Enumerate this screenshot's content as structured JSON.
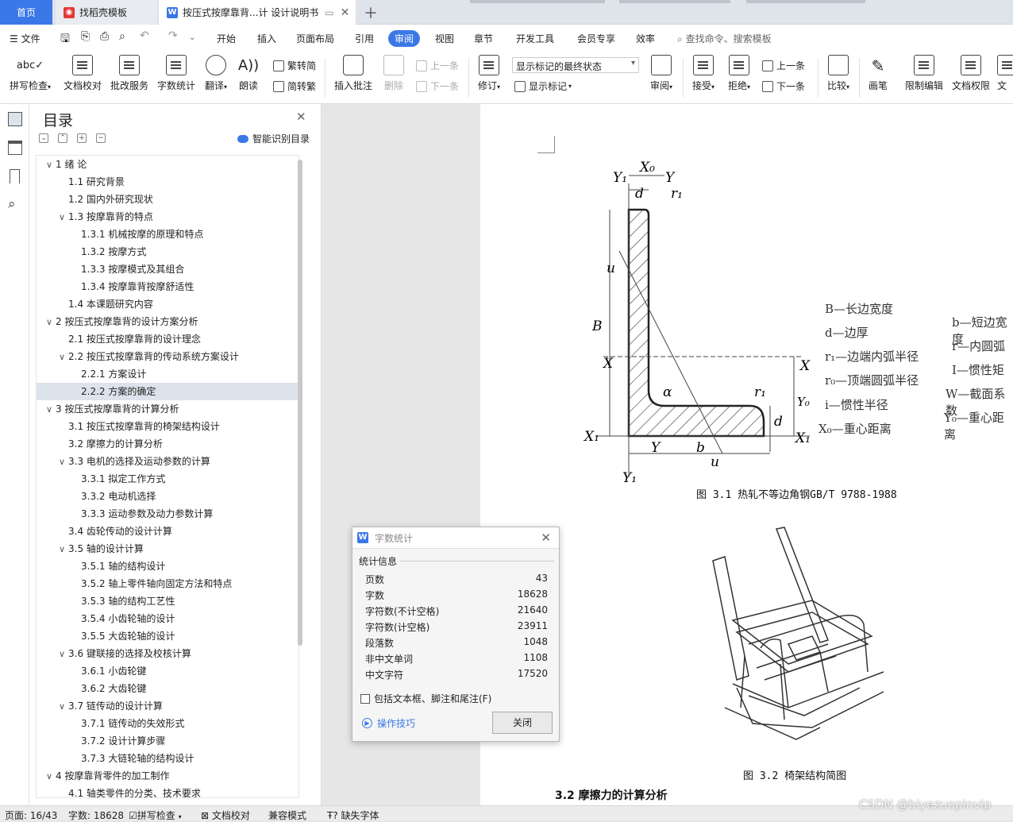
{
  "tabs": {
    "home": "首页",
    "find_template": "找稻壳模板",
    "doc_title": "按压式按摩靠背...计 设计说明书"
  },
  "menu": {
    "file": "文件",
    "items": [
      "开始",
      "插入",
      "页面布局",
      "引用",
      "审阅",
      "视图",
      "章节",
      "开发工具",
      "会员专享",
      "效率"
    ],
    "search": "查找命令、搜索模板"
  },
  "ribbon": {
    "spell": "拼写检查",
    "proof": "文档校对",
    "annot_service": "批改服务",
    "wordcount": "字数统计",
    "translate": "翻译",
    "read": "朗读",
    "trad": "繁转简",
    "simp": "简转繁",
    "insert_comment": "插入批注",
    "delete": "删除",
    "prev": "上一条",
    "next": "下一条",
    "track": "修订",
    "markup_state": "显示标记的最终状态",
    "show_markup": "显示标记",
    "review": "审阅",
    "accept": "接受",
    "reject": "拒绝",
    "prev2": "上一条",
    "next2": "下一条",
    "compare": "比较",
    "pen": "画笔",
    "restrict": "限制编辑",
    "doc_perm": "文档权限",
    "more": "文"
  },
  "toc": {
    "title": "目录",
    "smart": "智能识别目录",
    "items": [
      {
        "label": "1   绪   论",
        "level": 1,
        "arrow": "∨"
      },
      {
        "label": "1.1  研究背景",
        "level": 2,
        "arrow": ""
      },
      {
        "label": "1.2  国内外研究现状",
        "level": 2,
        "arrow": ""
      },
      {
        "label": "1.3  按摩靠背的特点",
        "level": 2,
        "arrow": "∨"
      },
      {
        "label": "1.3.1 机械按摩的原理和特点",
        "level": 3,
        "arrow": ""
      },
      {
        "label": "1.3.2 按摩方式",
        "level": 3,
        "arrow": ""
      },
      {
        "label": "1.3.3 按摩模式及其组合",
        "level": 3,
        "arrow": ""
      },
      {
        "label": "1.3.4 按摩靠背按摩舒适性",
        "level": 3,
        "arrow": ""
      },
      {
        "label": "1.4  本课题研究内容",
        "level": 2,
        "arrow": ""
      },
      {
        "label": "2   按压式按摩靠背的设计方案分析",
        "level": 1,
        "arrow": "∨"
      },
      {
        "label": "2.1  按压式按摩靠背的设计理念",
        "level": 2,
        "arrow": ""
      },
      {
        "label": "2.2  按压式按摩靠背的传动系统方案设计",
        "level": 2,
        "arrow": "∨"
      },
      {
        "label": "2.2.1 方案设计",
        "level": 3,
        "arrow": ""
      },
      {
        "label": "2.2.2 方案的确定",
        "level": 3,
        "arrow": "",
        "selected": true
      },
      {
        "label": "3   按压式按摩靠背的计算分析",
        "level": 1,
        "arrow": "∨"
      },
      {
        "label": "3.1  按压式按摩靠背的椅架结构设计",
        "level": 2,
        "arrow": ""
      },
      {
        "label": "3.2  摩擦力的计算分析",
        "level": 2,
        "arrow": ""
      },
      {
        "label": "3.3  电机的选择及运动参数的计算",
        "level": 2,
        "arrow": "∨"
      },
      {
        "label": "3.3.1 拟定工作方式",
        "level": 3,
        "arrow": ""
      },
      {
        "label": "3.3.2 电动机选择",
        "level": 3,
        "arrow": ""
      },
      {
        "label": "3.3.3 运动参数及动力参数计算",
        "level": 3,
        "arrow": ""
      },
      {
        "label": "3.4  齿轮传动的设计计算",
        "level": 2,
        "arrow": ""
      },
      {
        "label": "3.5  轴的设计计算",
        "level": 2,
        "arrow": "∨"
      },
      {
        "label": "3.5.1 轴的结构设计",
        "level": 3,
        "arrow": ""
      },
      {
        "label": "3.5.2 轴上零件轴向固定方法和特点",
        "level": 3,
        "arrow": ""
      },
      {
        "label": "3.5.3 轴的结构工艺性",
        "level": 3,
        "arrow": ""
      },
      {
        "label": "3.5.4 小齿轮轴的设计",
        "level": 3,
        "arrow": ""
      },
      {
        "label": "3.5.5 大齿轮轴的设计",
        "level": 3,
        "arrow": ""
      },
      {
        "label": "3.6  键联接的选择及校核计算",
        "level": 2,
        "arrow": "∨"
      },
      {
        "label": "3.6.1 小齿轮键",
        "level": 3,
        "arrow": ""
      },
      {
        "label": "3.6.2 大齿轮键",
        "level": 3,
        "arrow": ""
      },
      {
        "label": "3.7  链传动的设计计算",
        "level": 2,
        "arrow": "∨"
      },
      {
        "label": "3.7.1 链传动的失效形式",
        "level": 3,
        "arrow": ""
      },
      {
        "label": "3.7.2 设计计算步骤",
        "level": 3,
        "arrow": ""
      },
      {
        "label": "3.7.3 大链轮轴的结构设计",
        "level": 3,
        "arrow": ""
      },
      {
        "label": "4   按摩靠背零件的加工制作",
        "level": 1,
        "arrow": "∨"
      },
      {
        "label": "4.1  轴类零件的分类、技术要求",
        "level": 2,
        "arrow": ""
      }
    ]
  },
  "document": {
    "fig31_caption": "图 3.1 热轧不等边角钢GB/T 9788-1988",
    "fig32_caption": "图 3.2 椅架结构简图",
    "section_heading": "3.2  摩擦力的计算分析",
    "legend_left": [
      "B—长边宽度",
      "d—边厚",
      "r₁—边端内弧半径",
      "r₀—顶端圆弧半径",
      "i—惯性半径",
      "X₀—重心距离"
    ],
    "legend_right": [
      "b—短边宽度",
      "r—内圆弧",
      "I—惯性矩",
      "W—截面系数",
      "Y₀—重心距离"
    ],
    "diagram_labels": {
      "x0": "X₀",
      "y1": "Y₁",
      "y": "Y",
      "d": "d",
      "r1": "r₁",
      "u": "u",
      "B": "B",
      "X": "X",
      "x1": "X₁",
      "alpha": "α",
      "b": "b",
      "y0": "Y₀"
    }
  },
  "dialog": {
    "title": "字数统计",
    "section": "统计信息",
    "rows": [
      {
        "k": "页数",
        "v": "43"
      },
      {
        "k": "字数",
        "v": "18628"
      },
      {
        "k": "字符数(不计空格)",
        "v": "21640"
      },
      {
        "k": "字符数(计空格)",
        "v": "23911"
      },
      {
        "k": "段落数",
        "v": "1048"
      },
      {
        "k": "非中文单词",
        "v": "1108"
      },
      {
        "k": "中文字符",
        "v": "17520"
      }
    ],
    "checkbox": "包括文本框、脚注和尾注(F)",
    "tips": "操作技巧",
    "close": "关闭"
  },
  "status": {
    "page": "页面: 16/43",
    "words": "字数: 18628",
    "spell": "拼写检查",
    "proof": "文档校对",
    "compat": "兼容模式",
    "missing_font": "缺失字体"
  },
  "watermark": "CSDN @biyezuopinvip",
  "colors": {
    "accent": "#3b78e7",
    "selected_row": "#dde3ec"
  }
}
